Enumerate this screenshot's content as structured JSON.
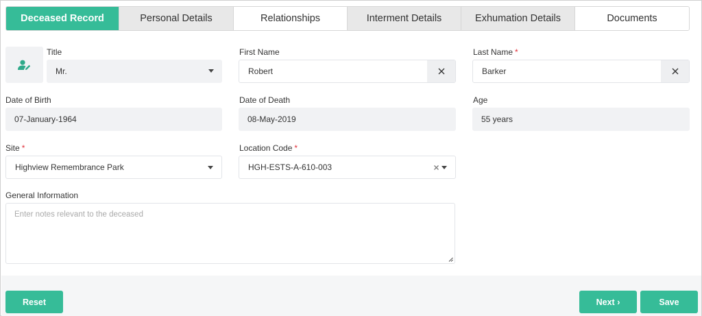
{
  "tabs": [
    {
      "label": "Deceased Record"
    },
    {
      "label": "Personal Details"
    },
    {
      "label": "Relationships"
    },
    {
      "label": "Interment Details"
    },
    {
      "label": "Exhumation Details"
    },
    {
      "label": "Documents"
    }
  ],
  "fields": {
    "title": {
      "label": "Title",
      "value": "Mr."
    },
    "first_name": {
      "label": "First Name",
      "value": "Robert"
    },
    "last_name": {
      "label": "Last Name",
      "value": "Barker",
      "required_mark": "*"
    },
    "dob": {
      "label": "Date of Birth",
      "value": "07-January-1964"
    },
    "dod": {
      "label": "Date of Death",
      "value": "08-May-2019"
    },
    "age": {
      "label": "Age",
      "value": "55 years"
    },
    "site": {
      "label": "Site",
      "value": "Highview Remembrance Park",
      "required_mark": "*"
    },
    "location_code": {
      "label": "Location Code",
      "value": "HGH-ESTS-A-610-003",
      "required_mark": "*"
    },
    "general_info": {
      "label": "General Information",
      "placeholder": "Enter notes relevant to the deceased"
    }
  },
  "footer": {
    "reset_label": "Reset",
    "next_label": "Next ›",
    "save_label": "Save"
  },
  "colors": {
    "accent": "#36bc98",
    "required": "#e0303a"
  },
  "icons": [
    "user-edit-icon",
    "caret-down-icon",
    "close-icon",
    "resize-handle-icon"
  ]
}
